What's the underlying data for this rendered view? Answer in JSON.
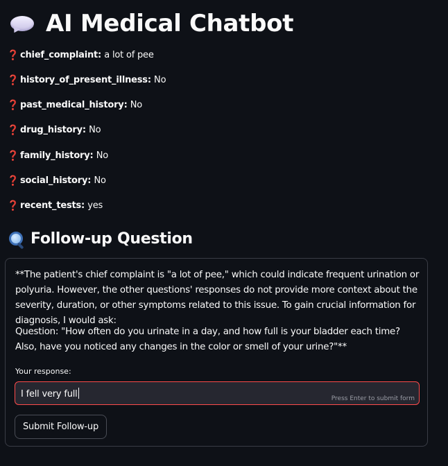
{
  "header": {
    "title": "AI Medical Chatbot",
    "icon": "speech-bubble-icon"
  },
  "fields": [
    {
      "key": "chief_complaint",
      "value": "a lot of pee"
    },
    {
      "key": "history_of_present_illness",
      "value": "No"
    },
    {
      "key": "past_medical_history",
      "value": "No"
    },
    {
      "key": "drug_history",
      "value": "No"
    },
    {
      "key": "family_history",
      "value": "No"
    },
    {
      "key": "social_history",
      "value": "No"
    },
    {
      "key": "recent_tests",
      "value": "yes"
    }
  ],
  "field_icon": "❓",
  "followup": {
    "heading": "Follow-up Question",
    "icon": "magnifier-icon",
    "paragraph1": "**The patient's chief complaint is \"a lot of pee,\" which could indicate frequent urination or polyuria. However, the other questions' responses do not provide more context about the severity, duration, or other symptoms related to this issue. To gain crucial information for diagnosis, I would ask:",
    "paragraph2": "Question: \"How often do you urinate in a day, and how full is your bladder each time? Also, have you noticed any changes in the color or smell of your urine?\"**",
    "input_label": "Your response:",
    "input_value": "I fell very full",
    "input_hint": "Press Enter to submit form",
    "submit_label": "Submit Follow-up"
  },
  "colors": {
    "background": "#0e1117",
    "input_background": "#262730",
    "input_focus_border": "#ff4b4b",
    "question_icon": "#e0303e"
  }
}
